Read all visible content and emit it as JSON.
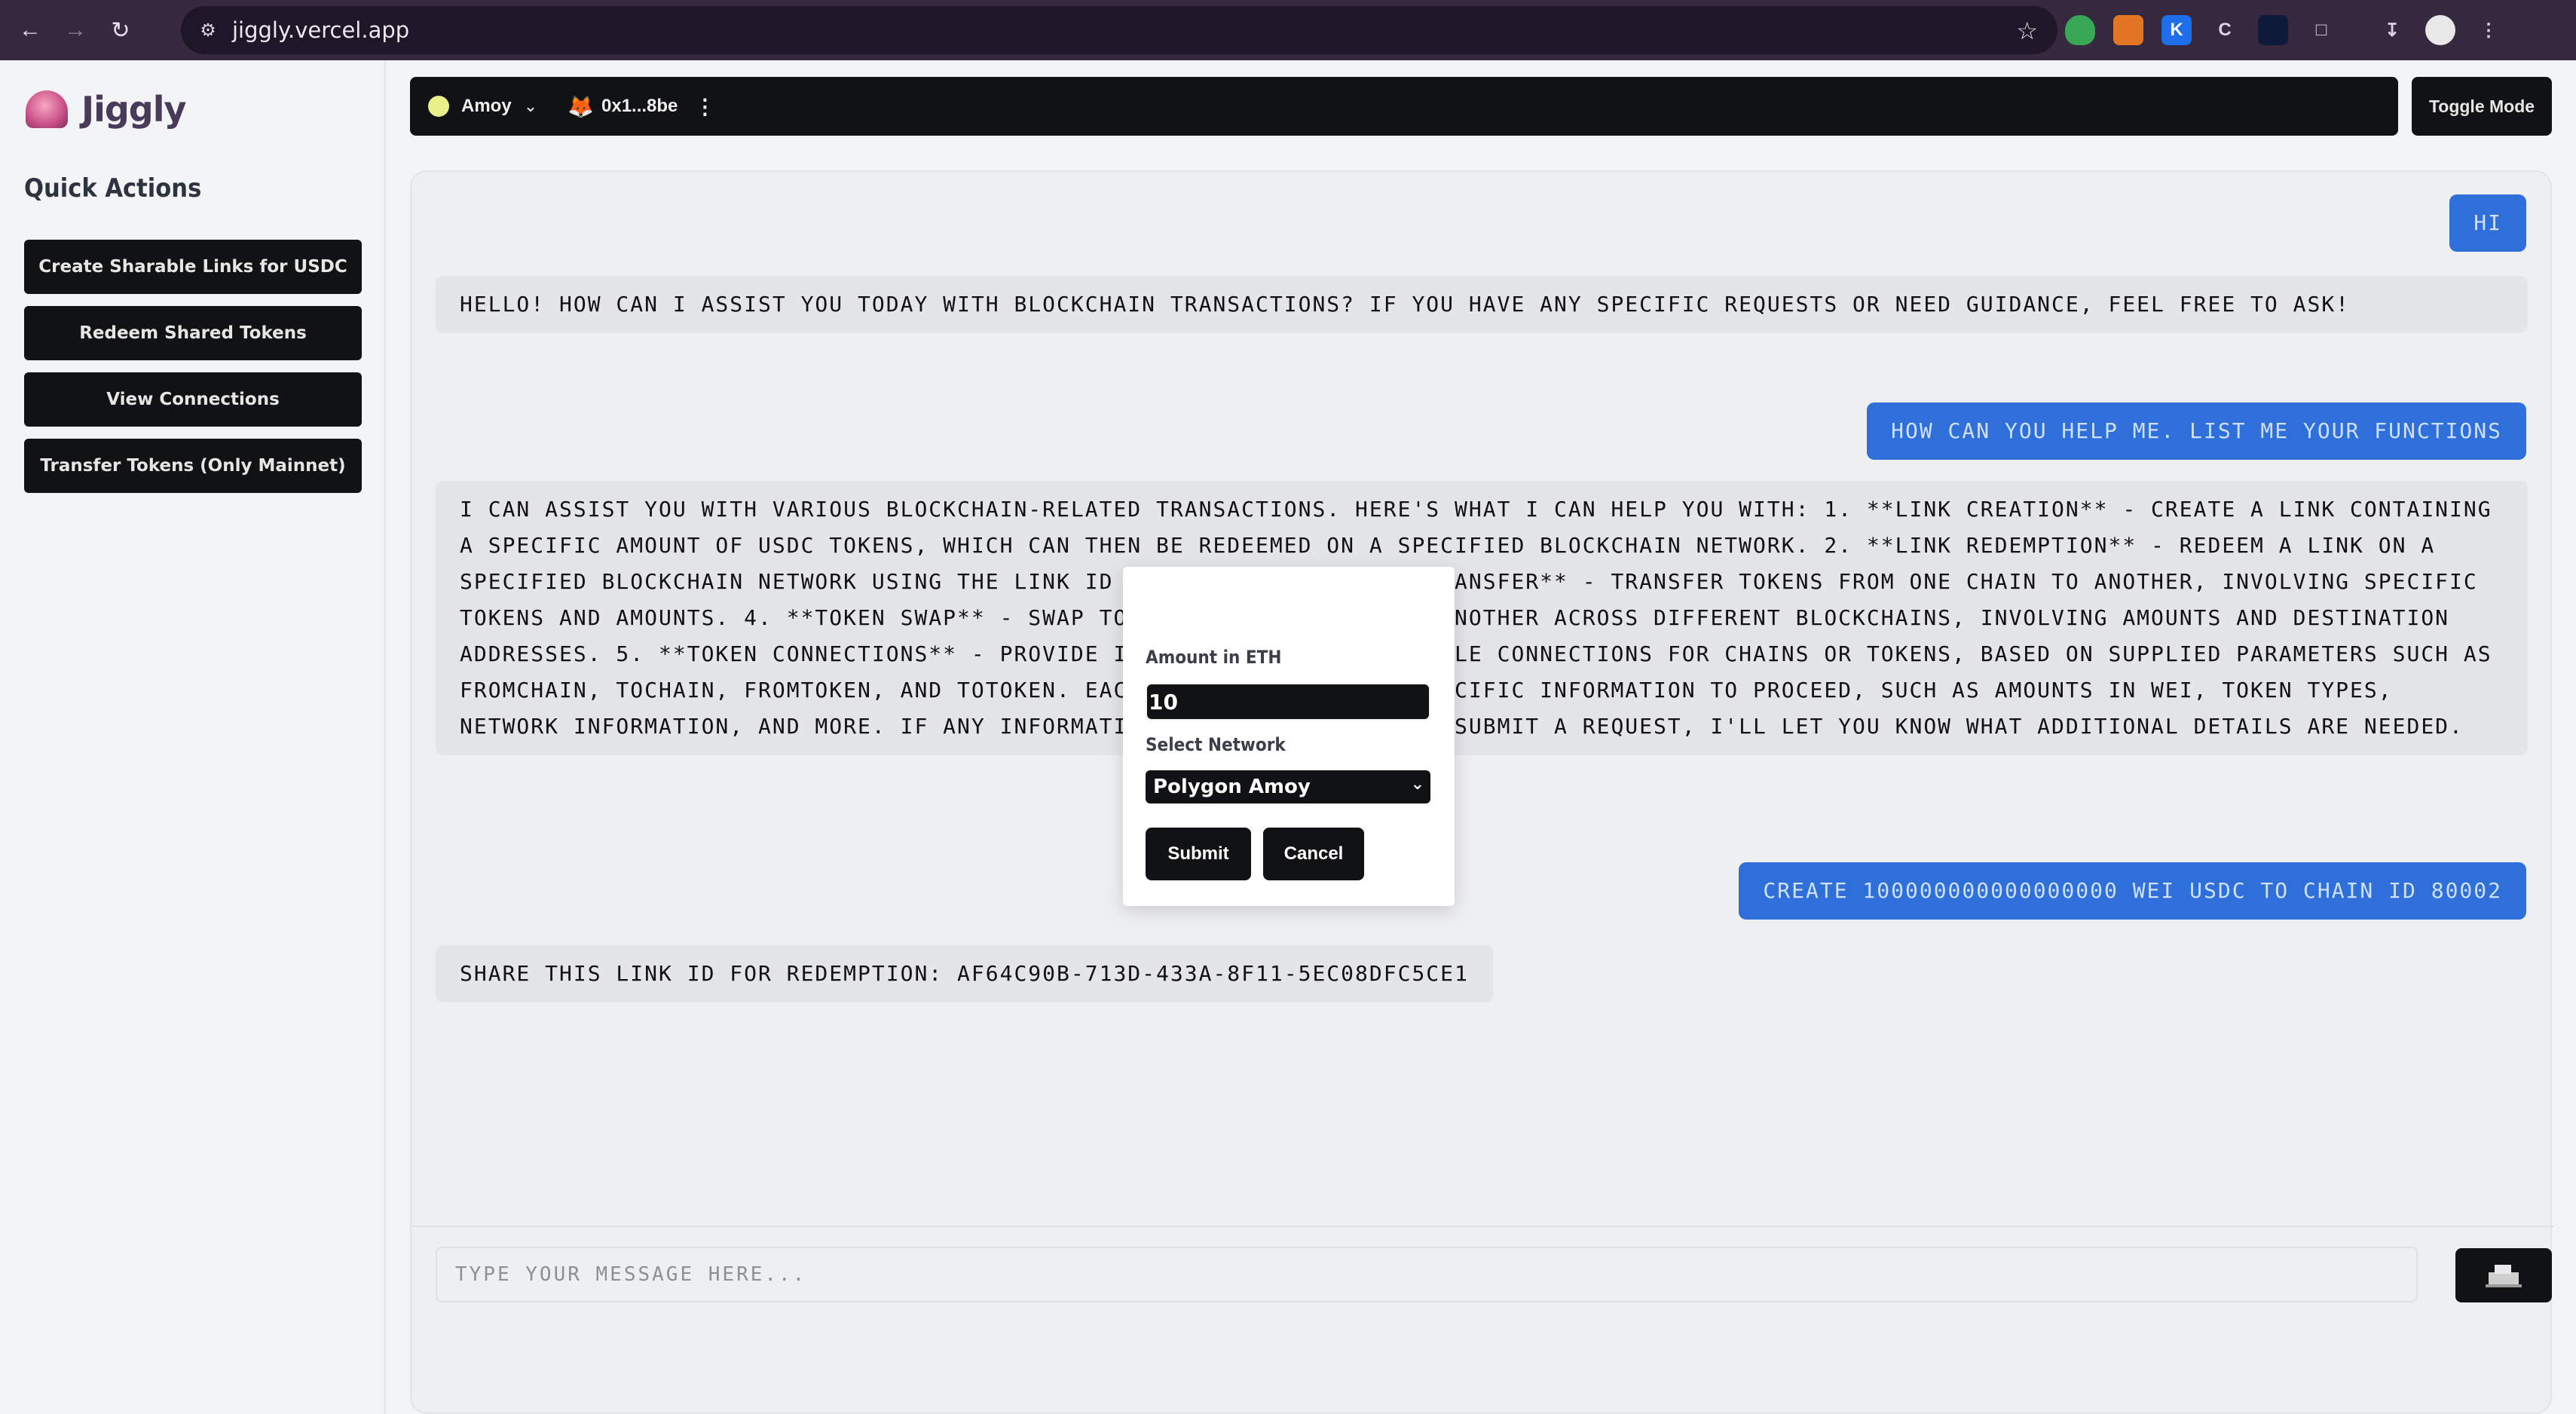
{
  "browser": {
    "url": "jiggly.vercel.app",
    "extensions": [
      "shield-ext",
      "metamask-ext",
      "k-ext",
      "ci-ext",
      "chart-ext",
      "puzzle-ext"
    ],
    "colors": {
      "chrome": "#35283f",
      "urlbar": "#1f1628"
    }
  },
  "sidebar": {
    "brand": "Jiggly",
    "quick_actions_title": "Quick Actions",
    "actions": [
      {
        "label": "Create Sharable Links for USDC"
      },
      {
        "label": "Redeem Shared Tokens"
      },
      {
        "label": "View Connections"
      },
      {
        "label": "Transfer Tokens (Only Mainnet)"
      }
    ]
  },
  "topbar": {
    "chain": "Amoy",
    "address": "0x1...8be",
    "toggle_label": "Toggle Mode"
  },
  "chat": {
    "messages": [
      {
        "role": "user",
        "text": "Hi"
      },
      {
        "role": "bot",
        "text": "Hello! How can I assist you today with blockchain transactions? If you have any specific requests or need guidance, feel free to ask!"
      },
      {
        "role": "user",
        "text": "How can you help me. List me your functions"
      },
      {
        "role": "bot",
        "text": "I can assist you with various blockchain-related transactions. Here's what I can help you with: 1. **Link Creation** - Create a link containing a specific amount of USDC tokens, which can then be redeemed on a specified blockchain network. 2. **Link Redemption** - Redeem a link on a specified blockchain network using the link ID provided. 3. **Token Transfer** - Transfer tokens from one chain to another, involving specific tokens and amounts. 4. **Token Swap** - Swap tokens from one type to another across different blockchains, involving amounts and destination addresses. 5. **Token Connections** - Provide information about possible connections for chains or tokens, based on supplied parameters such as fromChain, toChain, fromToken, and toToken. Each function requires specific information to proceed, such as amounts in wei, token types, network information, and more. If any information is missing when you submit a request, I'll let you know what additional details are needed."
      },
      {
        "role": "user",
        "text": "Create 100000000000000000 wei USDC to chain ID 80002"
      },
      {
        "role": "bot",
        "text": "Share this link ID for redemption: af64c90b-713d-433a-8f11-5ec08dfc5ce1"
      }
    ],
    "input_placeholder": "Type your message here..."
  },
  "modal": {
    "amount_label": "Amount in ETH",
    "amount_value": "10",
    "network_label": "Select Network",
    "network_value": "Polygon Amoy",
    "submit_label": "Submit",
    "cancel_label": "Cancel"
  },
  "colors": {
    "user_bubble": "#2f6fd9",
    "bot_bubble": "#e4e5e8",
    "dark_button": "#111214"
  }
}
